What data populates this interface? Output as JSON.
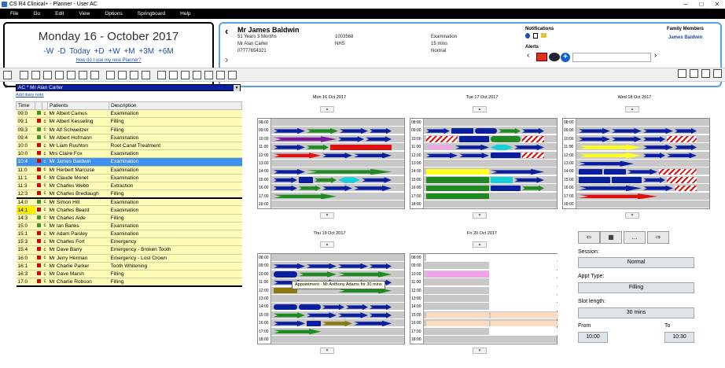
{
  "window": {
    "title": "CS R4 Clinical+ - Planner - User AC"
  },
  "menu": [
    "File",
    "Go",
    "Edit",
    "View",
    "Options",
    "Springboard",
    "Help"
  ],
  "date_panel": {
    "date": "Monday 16 - October 2017",
    "nav": "-W -D Today +D +W +M +3M +6M",
    "link": "How do I use my new Planner?"
  },
  "patient": {
    "name": "Mr James Baldwin",
    "age": "51 Years 3 Months",
    "dentist": "Mr Alan Carter",
    "phone": "07777654321",
    "id": "1003568",
    "nhs": "NHS",
    "appt_type": "Examination",
    "duration": "15 mins",
    "status": "Normal",
    "notifications_label": "Notifications",
    "alerts_label": "Alerts",
    "family_label": "Family Members",
    "family_member": "James Baldwin"
  },
  "diary": {
    "selected": "AC * Mr Alan Carter",
    "add_note": "Add diary note",
    "row_index": "0",
    "headers": {
      "time": "Time",
      "patients": "Patients",
      "description": "Description"
    }
  },
  "appointments": [
    {
      "time": "09:0",
      "flag": "c",
      "patient": "Mr Albert Camus",
      "desc": "Examination",
      "color": "#3a9a1a"
    },
    {
      "time": "09:1",
      "flag": "c",
      "patient": "Mr Albert Kesseling",
      "desc": "Filling",
      "color": "#e00000"
    },
    {
      "time": "09:3",
      "flag": "c",
      "patient": "Mr Alf Schweitzer",
      "desc": "Filling",
      "color": "#3a9a1a"
    },
    {
      "time": "09:4",
      "flag": "c",
      "patient": "Mr Albert Hofmann",
      "desc": "Examination",
      "color": "#3a9a1a"
    },
    {
      "time": "10:0",
      "flag": "c",
      "patient": "Mr Liam Rushton",
      "desc": "Root Canal Treatment",
      "color": "#e00000"
    },
    {
      "time": "10:0",
      "flag": "c",
      "patient": "Mrs Claire Fox",
      "desc": "Examination",
      "color": "#e00000"
    },
    {
      "time": "10:4",
      "flag": "c",
      "patient": "Mr James Baldwin",
      "desc": "Examination",
      "color": "#e00000"
    },
    {
      "time": "11:0",
      "flag": "c",
      "patient": "Mr Herbert Marcuse",
      "desc": "Examination",
      "color": "#e00000"
    },
    {
      "time": "11:1",
      "flag": "c",
      "patient": "Mr Claude Monet",
      "desc": "Examination",
      "color": "#e00000"
    },
    {
      "time": "11:3",
      "flag": "c",
      "patient": "Mr Charles Webb",
      "desc": "Extraction",
      "color": "#e00000"
    },
    {
      "time": "12:3",
      "flag": "c",
      "patient": "Mr Charles Bredlaugh",
      "desc": "Filling",
      "color": "#e00000"
    },
    {
      "time": "14:0",
      "flag": "c",
      "patient": "Mr Simon Hill",
      "desc": "Examination",
      "color": "#3a9a1a"
    },
    {
      "time": "14:1",
      "flag": "c",
      "patient": "Mr Charles Beard",
      "desc": "Examination",
      "color": "#e00000"
    },
    {
      "time": "14:3",
      "flag": "c",
      "patient": "Mr Charles Aide",
      "desc": "Filling",
      "color": "#3a9a1a"
    },
    {
      "time": "15:0",
      "flag": "c",
      "patient": "Mr Ian Banks",
      "desc": "Examination",
      "color": "#3a9a1a"
    },
    {
      "time": "15:1",
      "flag": "c",
      "patient": "Mr Adam Paisley",
      "desc": "Examination",
      "color": "#e00000"
    },
    {
      "time": "15:3",
      "flag": "c",
      "patient": "Mr Charles Fort",
      "desc": "Emergency",
      "color": "#e00000"
    },
    {
      "time": "15:4",
      "flag": "c",
      "patient": "Mr Dave Barry",
      "desc": "Emergency - Broken Tooth",
      "color": "#e00000"
    },
    {
      "time": "16:0",
      "flag": "c",
      "patient": "Mr Jerry Herman",
      "desc": "Emergency - Lost Crown",
      "color": "#e00000"
    },
    {
      "time": "16:1",
      "flag": "c",
      "patient": "Mr Charlie Parker",
      "desc": "Tooth Whitening",
      "color": "#e00000"
    },
    {
      "time": "16:3",
      "flag": "c",
      "patient": "Mr Dave Marsh",
      "desc": "Filling",
      "color": "#e00000"
    },
    {
      "time": "17:0",
      "flag": "c",
      "patient": "Mr Charlie Robson",
      "desc": "Filling",
      "color": "#e00000"
    }
  ],
  "times": [
    "08:00",
    "09:00",
    "10:00",
    "11:00",
    "12:00",
    "13:00",
    "14:00",
    "15:00",
    "16:00",
    "17:00",
    "18:00"
  ],
  "days": [
    {
      "label": "Mon 16 Oct 2017"
    },
    {
      "label": "Tue 17 Oct 2017"
    },
    {
      "label": "Wed 18 Oct 2017"
    },
    {
      "label": "Thu 19 Oct 2017"
    },
    {
      "label": "Fri 20 Oct 2017"
    }
  ],
  "tooltip": "Appointment - Mr Anthony Adams for 30 mins",
  "right_panel": {
    "session_label": "Session:",
    "session_value": "Normal",
    "appt_type_label": "Appt Type:",
    "appt_type_value": "Filling",
    "slot_label": "Slot length:",
    "slot_value": "30 mins",
    "from_label": "From",
    "to_label": "To",
    "from_value": "10:00",
    "to_value": "10:30",
    "more_label": "..."
  },
  "colors": {
    "blue": "#0a1fa0",
    "green": "#1f8a1f",
    "red": "#e01010",
    "cyan": "#14d0d8",
    "yellow": "#ffff20",
    "purple": "#7a1a9a",
    "pink": "#f6a0f0",
    "peach": "#fbdcc0",
    "olive": "#8a7a10"
  }
}
